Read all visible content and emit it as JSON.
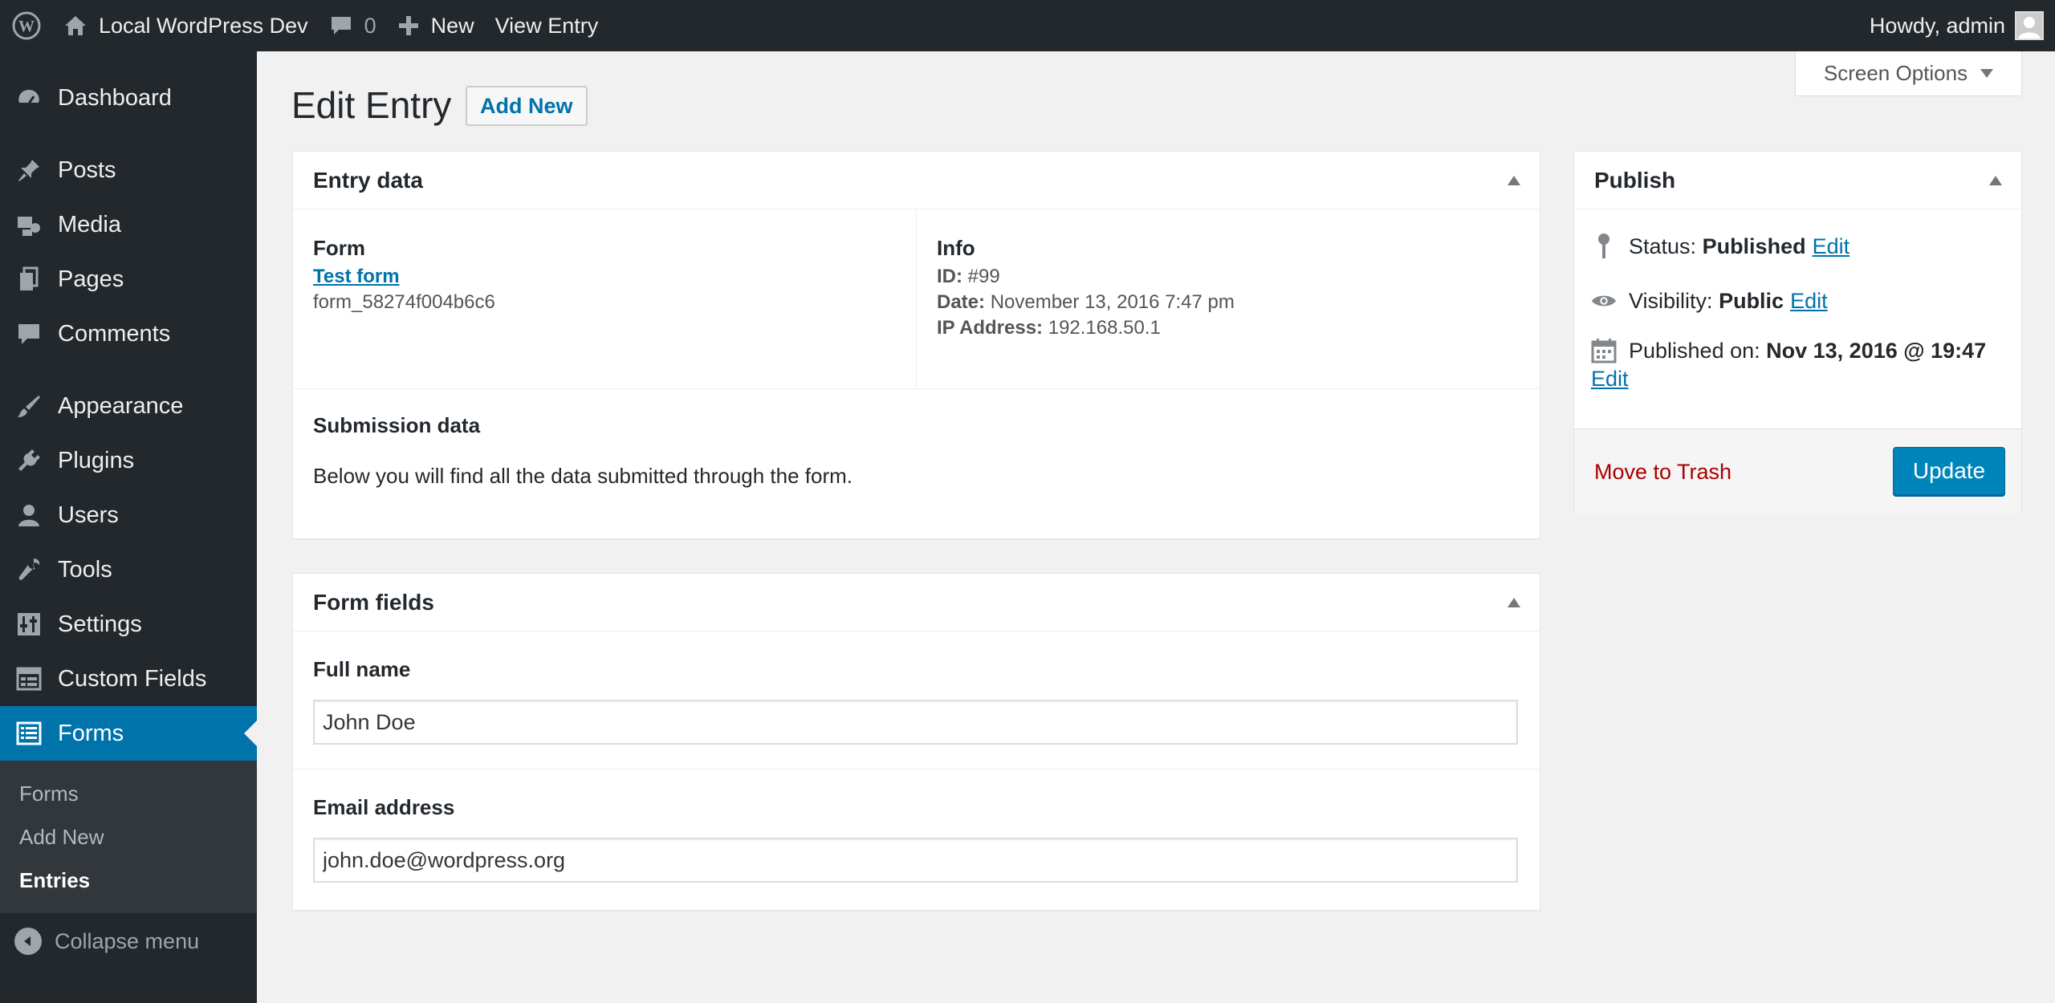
{
  "adminbar": {
    "site_name": "Local WordPress Dev",
    "comments_count": "0",
    "new_label": "New",
    "view_label": "View Entry",
    "greeting": "Howdy, admin"
  },
  "sidebar": {
    "items": [
      {
        "label": "Dashboard"
      },
      {
        "label": "Posts"
      },
      {
        "label": "Media"
      },
      {
        "label": "Pages"
      },
      {
        "label": "Comments"
      },
      {
        "label": "Appearance"
      },
      {
        "label": "Plugins"
      },
      {
        "label": "Users"
      },
      {
        "label": "Tools"
      },
      {
        "label": "Settings"
      },
      {
        "label": "Custom Fields"
      },
      {
        "label": "Forms"
      }
    ],
    "submenu": [
      "Forms",
      "Add New",
      "Entries"
    ],
    "collapse": "Collapse menu"
  },
  "header": {
    "screen_options": "Screen Options",
    "title": "Edit Entry",
    "add_new": "Add New"
  },
  "entry_data": {
    "title": "Entry data",
    "form_heading": "Form",
    "form_link": "Test form",
    "form_id": "form_58274f004b6c6",
    "info_heading": "Info",
    "id_label": "ID:",
    "id_value": "#99",
    "date_label": "Date:",
    "date_value": "November 13, 2016 7:47 pm",
    "ip_label": "IP Address:",
    "ip_value": "192.168.50.1",
    "submission_heading": "Submission data",
    "submission_text": "Below you will find all the data submitted through the form."
  },
  "form_fields": {
    "title": "Form fields",
    "full_name_label": "Full name",
    "full_name_value": "John Doe",
    "email_label": "Email address",
    "email_value": "john.doe@wordpress.org"
  },
  "publish": {
    "title": "Publish",
    "status_label": "Status:",
    "status_value": "Published",
    "visibility_label": "Visibility:",
    "visibility_value": "Public",
    "published_label": "Published on:",
    "published_value": "Nov 13, 2016 @ 19:47",
    "edit_label": "Edit",
    "trash_label": "Move to Trash",
    "update_label": "Update"
  },
  "colors": {
    "accent": "#0073aa",
    "adminbar_bg": "#23282d",
    "trash": "#aa0000",
    "update_button": "#0085ba"
  }
}
